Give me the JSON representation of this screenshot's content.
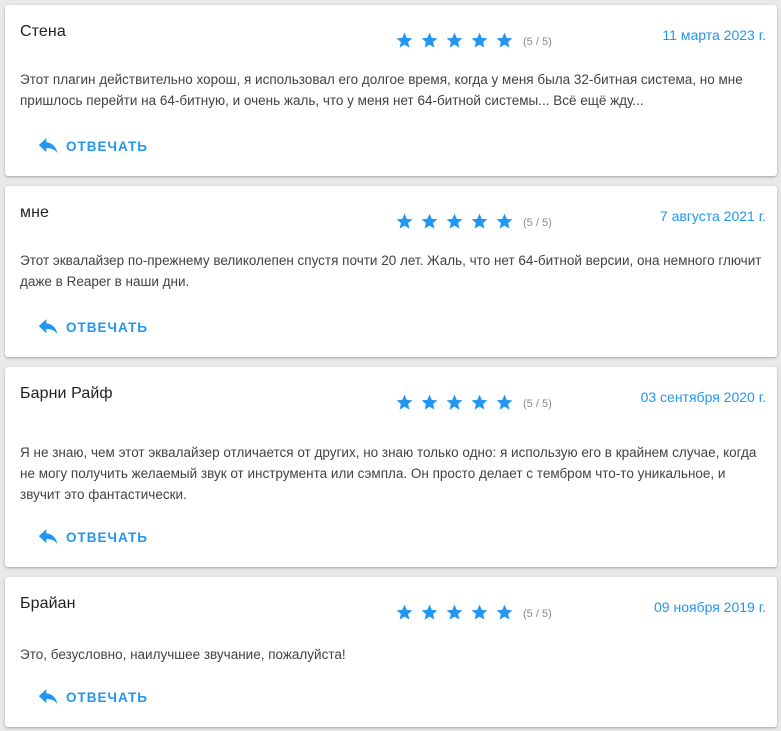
{
  "colors": {
    "accent": "#2196f3",
    "star": "#2196f3",
    "text": "#424242",
    "background": "#e9e9e9"
  },
  "reply_label": "ОТВЕЧАТЬ",
  "reviews": [
    {
      "author": "Стена",
      "rating": 5,
      "score": "(5 / 5)",
      "date": "11 марта 2023 г.",
      "text": "Этот плагин действительно хорош, я использовал его долгое время, когда у меня была 32-битная система, но мне пришлось перейти на 64-битную, и очень жаль, что у меня нет 64-битной системы... Всё ещё жду..."
    },
    {
      "author": "мне",
      "rating": 5,
      "score": "(5 / 5)",
      "date": "7 августа 2021 г.",
      "text": "Этот эквалайзер по-прежнему великолепен спустя почти 20 лет. Жаль, что нет 64-битной версии, она немного глючит даже в Reaper в наши дни."
    },
    {
      "author": "Барни Райф",
      "rating": 5,
      "score": "(5 / 5)",
      "date": "03 сентября 2020 г.",
      "text": "Я не знаю, чем этот эквалайзер отличается от других, но знаю только одно: я использую его в крайнем случае, когда не могу получить желаемый звук от инструмента или сэмпла. Он просто делает с тембром что-то уникальное, и звучит это фантастически."
    },
    {
      "author": "Брайан",
      "rating": 5,
      "score": "(5 / 5)",
      "date": "09 ноября 2019 г.",
      "text": "Это, безусловно, наилучшее звучание, пожалуйста!"
    }
  ]
}
